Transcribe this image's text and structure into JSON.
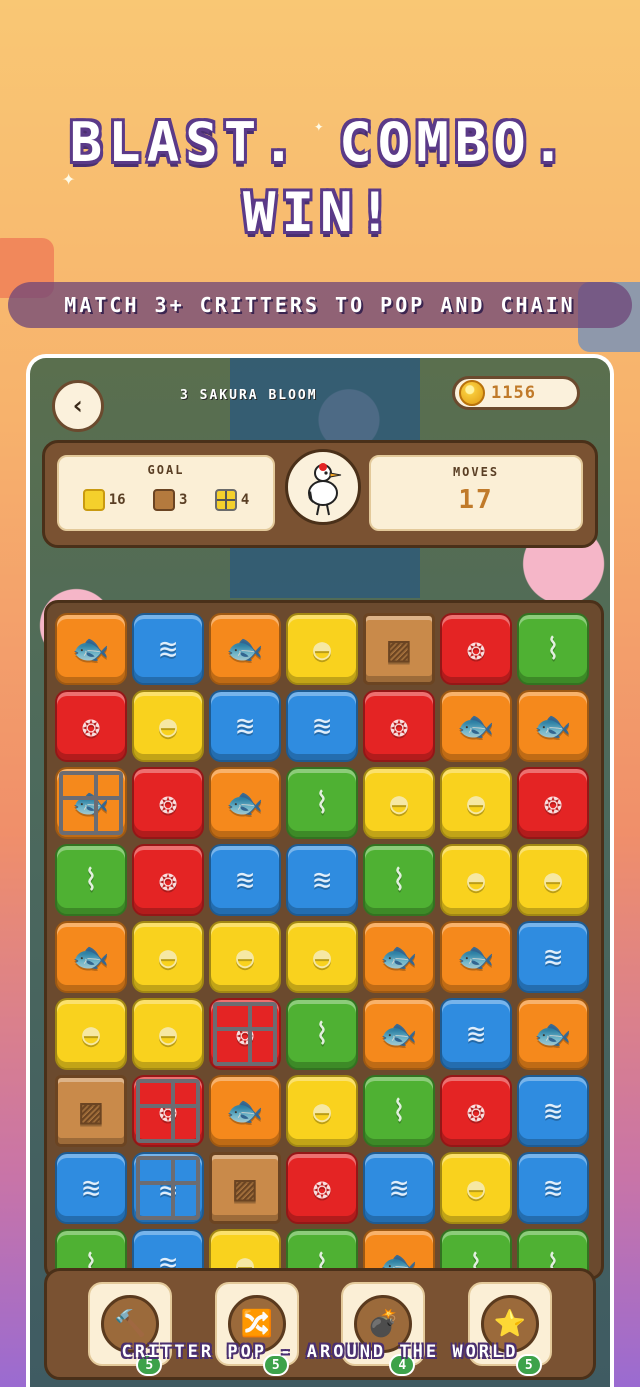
{
  "hero": {
    "line1": "BLAST. COMBO.",
    "line2": "WIN!",
    "tagline": "MATCH 3+ CRITTERS TO POP AND CHAIN"
  },
  "hud": {
    "level_name": "3  SAKURA BLOOM",
    "coins": "1156",
    "goal_label": "GOAL",
    "goals": [
      {
        "icon": "yellow-shell-tile-icon",
        "count": "16"
      },
      {
        "icon": "crate-icon",
        "count": "3"
      },
      {
        "icon": "cage-icon",
        "count": "4"
      }
    ],
    "moves_label": "MOVES",
    "moves": "17"
  },
  "board": {
    "rows": [
      [
        "koi",
        "wave",
        "koi",
        "shell",
        "crate",
        "lantern",
        "bamboo"
      ],
      [
        "lantern",
        "shell",
        "wave",
        "wave",
        "lantern",
        "koi",
        "koi"
      ],
      [
        "koi-caged",
        "lantern",
        "koi",
        "bamboo",
        "shell",
        "shell",
        "lantern"
      ],
      [
        "bamboo",
        "lantern",
        "wave",
        "wave",
        "bamboo",
        "shell",
        "shell"
      ],
      [
        "koi",
        "shell",
        "shell",
        "shell",
        "koi",
        "koi",
        "wave"
      ],
      [
        "shell",
        "shell",
        "lantern-caged",
        "bamboo",
        "koi",
        "wave",
        "koi"
      ],
      [
        "crate",
        "lantern-caged",
        "koi",
        "shell",
        "bamboo",
        "lantern",
        "wave"
      ],
      [
        "wave",
        "wave-caged",
        "crate",
        "lantern",
        "wave",
        "shell",
        "wave"
      ],
      [
        "bamboo",
        "wave",
        "shell",
        "bamboo",
        "koi",
        "bamboo",
        "bamboo"
      ]
    ]
  },
  "boosters": [
    {
      "icon": "hammer-icon",
      "count": "5"
    },
    {
      "icon": "shuffle-icon",
      "count": "5"
    },
    {
      "icon": "bomb-icon",
      "count": "4"
    },
    {
      "icon": "rainbow-star-icon",
      "count": "5"
    }
  ],
  "footer": "CRITTER POP - AROUND THE WORLD",
  "colors": {
    "koi": "#f5891c",
    "wave": "#2f8ce0",
    "shell": "#f9d21e",
    "lantern": "#e42424",
    "bamboo": "#4fb133",
    "crate": "#c98a4a"
  }
}
